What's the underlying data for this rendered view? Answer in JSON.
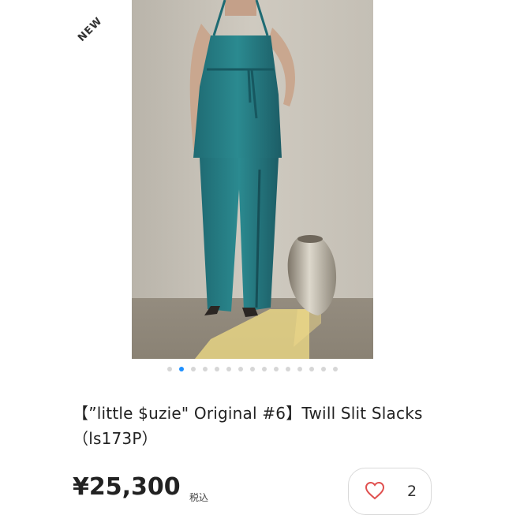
{
  "badge": {
    "label": "NEW"
  },
  "photo": {
    "alt": "model wearing teal halter top and twill slit slacks beside a stone vase"
  },
  "carousel": {
    "count": 15,
    "active_index": 1
  },
  "product": {
    "title": "【”little $uzie\" Original #6】Twill Slit Slacks （ls173P）",
    "price": "¥25,300",
    "tax_label": "税込"
  },
  "like": {
    "icon": "heart-outline-icon",
    "count": "2"
  },
  "colors": {
    "accent": "#1e90ff",
    "heart": "#e0504f"
  }
}
